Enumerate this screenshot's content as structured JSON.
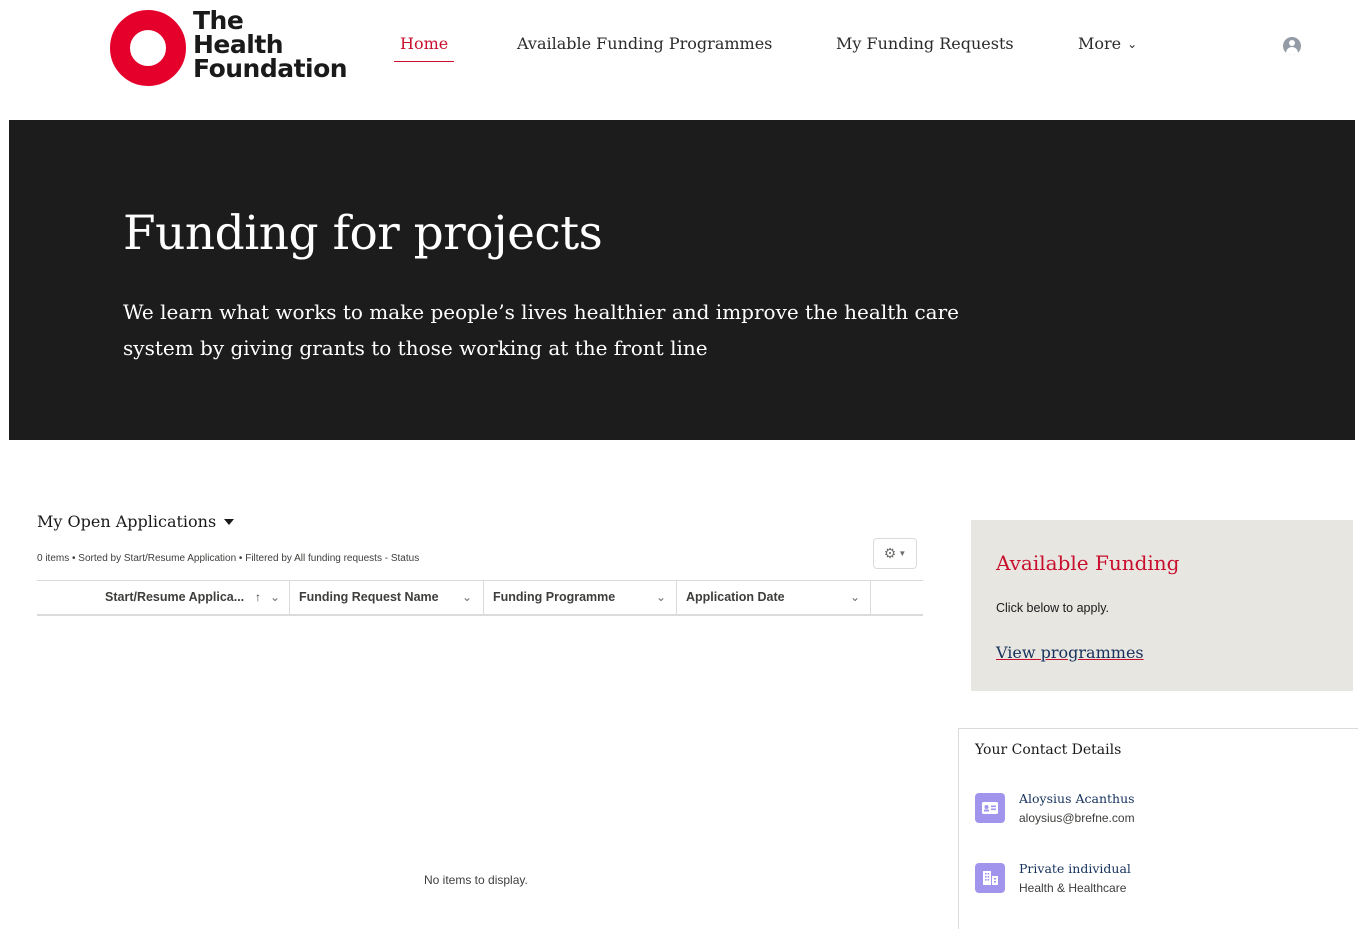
{
  "logo": {
    "lines": [
      "The",
      "Health",
      "Foundation"
    ],
    "brand_color": "#e4002b"
  },
  "nav": {
    "items": [
      {
        "label": "Home",
        "active": true
      },
      {
        "label": "Available Funding Programmes",
        "active": false
      },
      {
        "label": "My Funding Requests",
        "active": false
      },
      {
        "label": "More",
        "active": false,
        "has_dropdown": true
      }
    ],
    "active_color": "#c8102e",
    "user_icon": "user-avatar-icon"
  },
  "hero": {
    "title": "Funding for projects",
    "subtitle_line1": "We learn what works to make people’s lives healthier and improve the health care",
    "subtitle_line2": "system by giving grants to those working at the front line",
    "background": "#1c1c1c"
  },
  "list_view": {
    "title": "My Open Applications",
    "meta": "0 items • Sorted by Start/Resume Application • Filtered by All funding requests - Status",
    "settings_icon": "gear-icon",
    "columns": [
      {
        "label": "Start/Resume Applica...",
        "sorted": "ascending"
      },
      {
        "label": "Funding Request Name"
      },
      {
        "label": "Funding Programme"
      },
      {
        "label": "Application Date"
      }
    ],
    "rows": [],
    "empty_message": "No items to display."
  },
  "available_funding": {
    "title": "Available Funding",
    "text": "Click below to apply.",
    "link_label": "View programmes",
    "background": "#e8e6e1"
  },
  "contact": {
    "title": "Your Contact Details",
    "items": [
      {
        "name": "Aloysius Acanthus",
        "sub": "aloysius@brefne.com",
        "icon": "contact-card-icon"
      },
      {
        "name": "Private individual",
        "sub": "Health & Healthcare",
        "icon": "building-icon"
      }
    ],
    "icon_color": "#a094ed"
  }
}
